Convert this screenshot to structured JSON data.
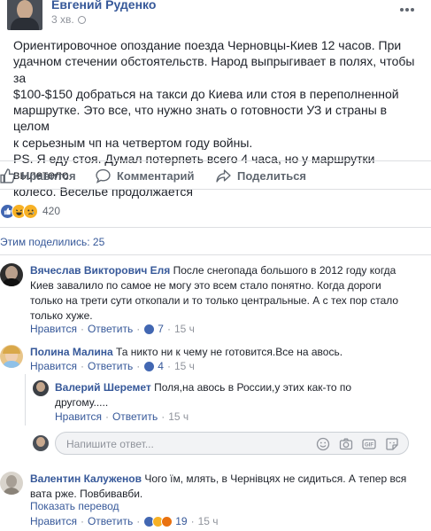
{
  "post": {
    "author": "Евгений Руденко",
    "time": "3 хв.",
    "body": "Ориентировочное опоздание поезда Черновцы-Киев 12 часов. При\nудачном стечении обстоятельств. Народ выпрыгивает в полях, чтобы за\n$100-$150 добраться на такси до Киева или стоя в переполненной\nмаршрутке. Это все, что нужно знать о готовности УЗ и страны в целом\nк серьезным чп на четвертом году войны.\nPS. Я еду стоя. Думал потерпеть всего 4 часа, но у маршрутки вылетело\nколесо. Веселье продолжается"
  },
  "actions": {
    "like": "Нравится",
    "comment": "Комментарий",
    "share": "Поделиться"
  },
  "reactions": {
    "count": "420",
    "types": [
      "like-icon",
      "haha-icon",
      "sad-icon"
    ]
  },
  "shares": "Этим поделились: 25",
  "comments": [
    {
      "name": "Вячеслав Викторович Еля",
      "text": "После снегопада большого в 2012 году когда Киев завалило по самое не могу это всем стало понятно. Когда дороги только на трети сути откопали и то только центральные. А с тех пор стало только хуже.",
      "like": "Нравится",
      "reply": "Ответить",
      "reactions": "7",
      "time": "15 ч"
    },
    {
      "name": "Полина Малина",
      "text": "Та никто ни к чему не готовится.Все на авось.",
      "like": "Нравится",
      "reply": "Ответить",
      "reactions": "4",
      "time": "15 ч"
    },
    {
      "name": "Валерий Шеремет",
      "text": "Поля,на авось в России,у этих как-то по другому.....",
      "like": "Нравится",
      "reply": "Ответить",
      "time": "15 ч"
    },
    {
      "name": "Валентин Калуженов",
      "text": "Чого їм, млять, в Чернівцях не сидиться. А тепер вся вата рже. Повбивавби.",
      "translate": "Показать перевод",
      "like": "Нравится",
      "reply": "Ответить",
      "reactions": "19",
      "time": "15 ч"
    }
  ],
  "reply_box": {
    "placeholder": "Напишите ответ..."
  },
  "colors": {
    "link": "#365899",
    "meta": "#90949c",
    "like_blue": "#4267b2",
    "reaction_yellow": "#f7b125"
  }
}
